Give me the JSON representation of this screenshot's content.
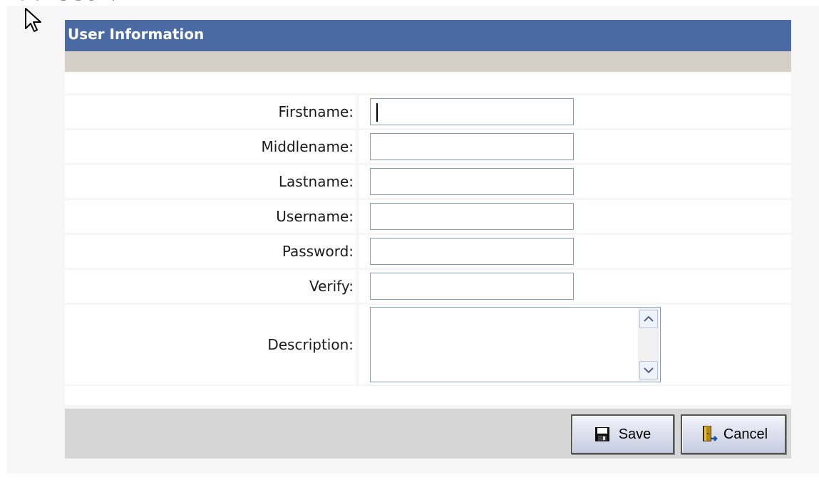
{
  "page": {
    "heading": "Add User:"
  },
  "header": {
    "title": "User Information"
  },
  "form": {
    "fields": [
      {
        "label": "Firstname:",
        "value": ""
      },
      {
        "label": "Middlename:",
        "value": ""
      },
      {
        "label": "Lastname:",
        "value": ""
      },
      {
        "label": "Username:",
        "value": ""
      },
      {
        "label": "Password:",
        "value": ""
      },
      {
        "label": "Verify:",
        "value": ""
      }
    ],
    "description": {
      "label": "Description:",
      "value": ""
    }
  },
  "buttons": {
    "save": "Save",
    "cancel": "Cancel"
  },
  "colors": {
    "header_bg": "#4a6aa3",
    "input_border": "#7f9db9",
    "button_bar": "#d6d6d6"
  },
  "icons": [
    "cursor-icon",
    "floppy-disk-icon",
    "exit-door-icon",
    "scroll-up-icon",
    "scroll-down-icon"
  ]
}
